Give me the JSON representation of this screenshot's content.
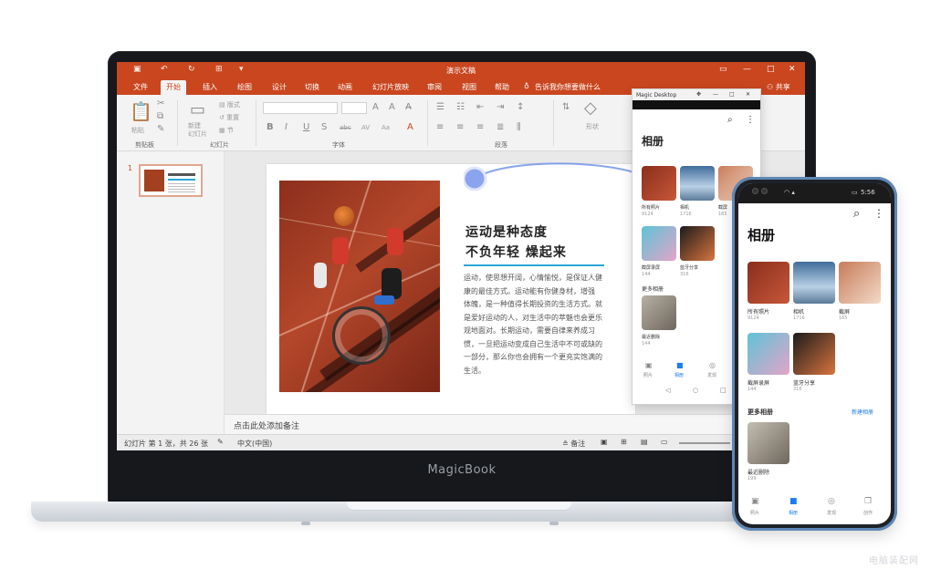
{
  "laptop": {
    "brand": "MagicBook",
    "ppt": {
      "window_title": "演示文稿",
      "tabs": [
        "文件",
        "开始",
        "插入",
        "绘图",
        "设计",
        "切换",
        "动画",
        "幻灯片放映",
        "审阅",
        "视图",
        "帮助"
      ],
      "active_tab": "开始",
      "search_hint": "告诉我你想要做什么",
      "share_label": "共享",
      "ribbon": {
        "paste": "粘贴",
        "new_slide": "新建\n幻灯片",
        "layout": "版式",
        "reset": "重置",
        "section": "节",
        "shape": "形状",
        "bold": "B",
        "italic": "I",
        "underline": "U",
        "strike": "S",
        "abc": "abc",
        "av": "AV",
        "aa": "Aa",
        "group_clipboard": "剪贴板",
        "group_slides": "幻灯片",
        "group_font": "字体",
        "group_paragraph": "段落"
      },
      "thumb_number": "1",
      "slide": {
        "heading1": "运动是种态度",
        "heading2": "不负年轻 燥起来",
        "body": [
          "运动，使思想开阔，心情愉悦，是保证人健",
          "康的最佳方式。运动能有你健身材，增强",
          "体魄，是一种值得长期投资的生活方式。就",
          "是爱好运动的人，对生活中的萃魅也会更乐",
          "观地面对。长期运动，需要自律来养成习",
          "惯，一旦把运动变成自己生活中不可或缺的",
          "一部分，那么你也会拥有一个更充实饱满的",
          "生活。"
        ]
      },
      "notes_placeholder": "点击此处添加备注",
      "status": {
        "slide_info": "幻灯片 第 1 张，共 26 张",
        "language": "中文(中国)",
        "notes_btn": "备注"
      }
    },
    "magic_desktop": {
      "title": "Magic Desktop",
      "album_title": "相册",
      "items": [
        {
          "name": "所有照片",
          "count": "9124"
        },
        {
          "name": "相机",
          "count": "1716"
        },
        {
          "name": "截屏",
          "count": "165"
        },
        {
          "name": "截屏录屏",
          "count": "144"
        },
        {
          "name": "蓝牙分享",
          "count": "316"
        }
      ],
      "more": "更多相册",
      "more_item": {
        "name": "最近删除",
        "count": "144"
      },
      "nav": [
        "照片",
        "相册",
        "发现"
      ]
    }
  },
  "phone": {
    "status_time": "5:56",
    "album_title": "相册",
    "items": [
      {
        "name": "所有照片",
        "count": "9124"
      },
      {
        "name": "相机",
        "count": "1716"
      },
      {
        "name": "截屏",
        "count": "165"
      },
      {
        "name": "截屏录屏",
        "count": "144"
      },
      {
        "name": "蓝牙分享",
        "count": "316"
      }
    ],
    "more": "更多相册",
    "new_album": "新建相册",
    "more_item": {
      "name": "最近删除",
      "count": "199"
    },
    "nav": [
      "照片",
      "相册",
      "发现",
      "创作"
    ]
  },
  "watermark": "电脑装配网",
  "colors": {
    "ppt_accent": "#c9461f",
    "link_blue": "#2aa7d6",
    "phone_frame": "#5f87b5"
  }
}
